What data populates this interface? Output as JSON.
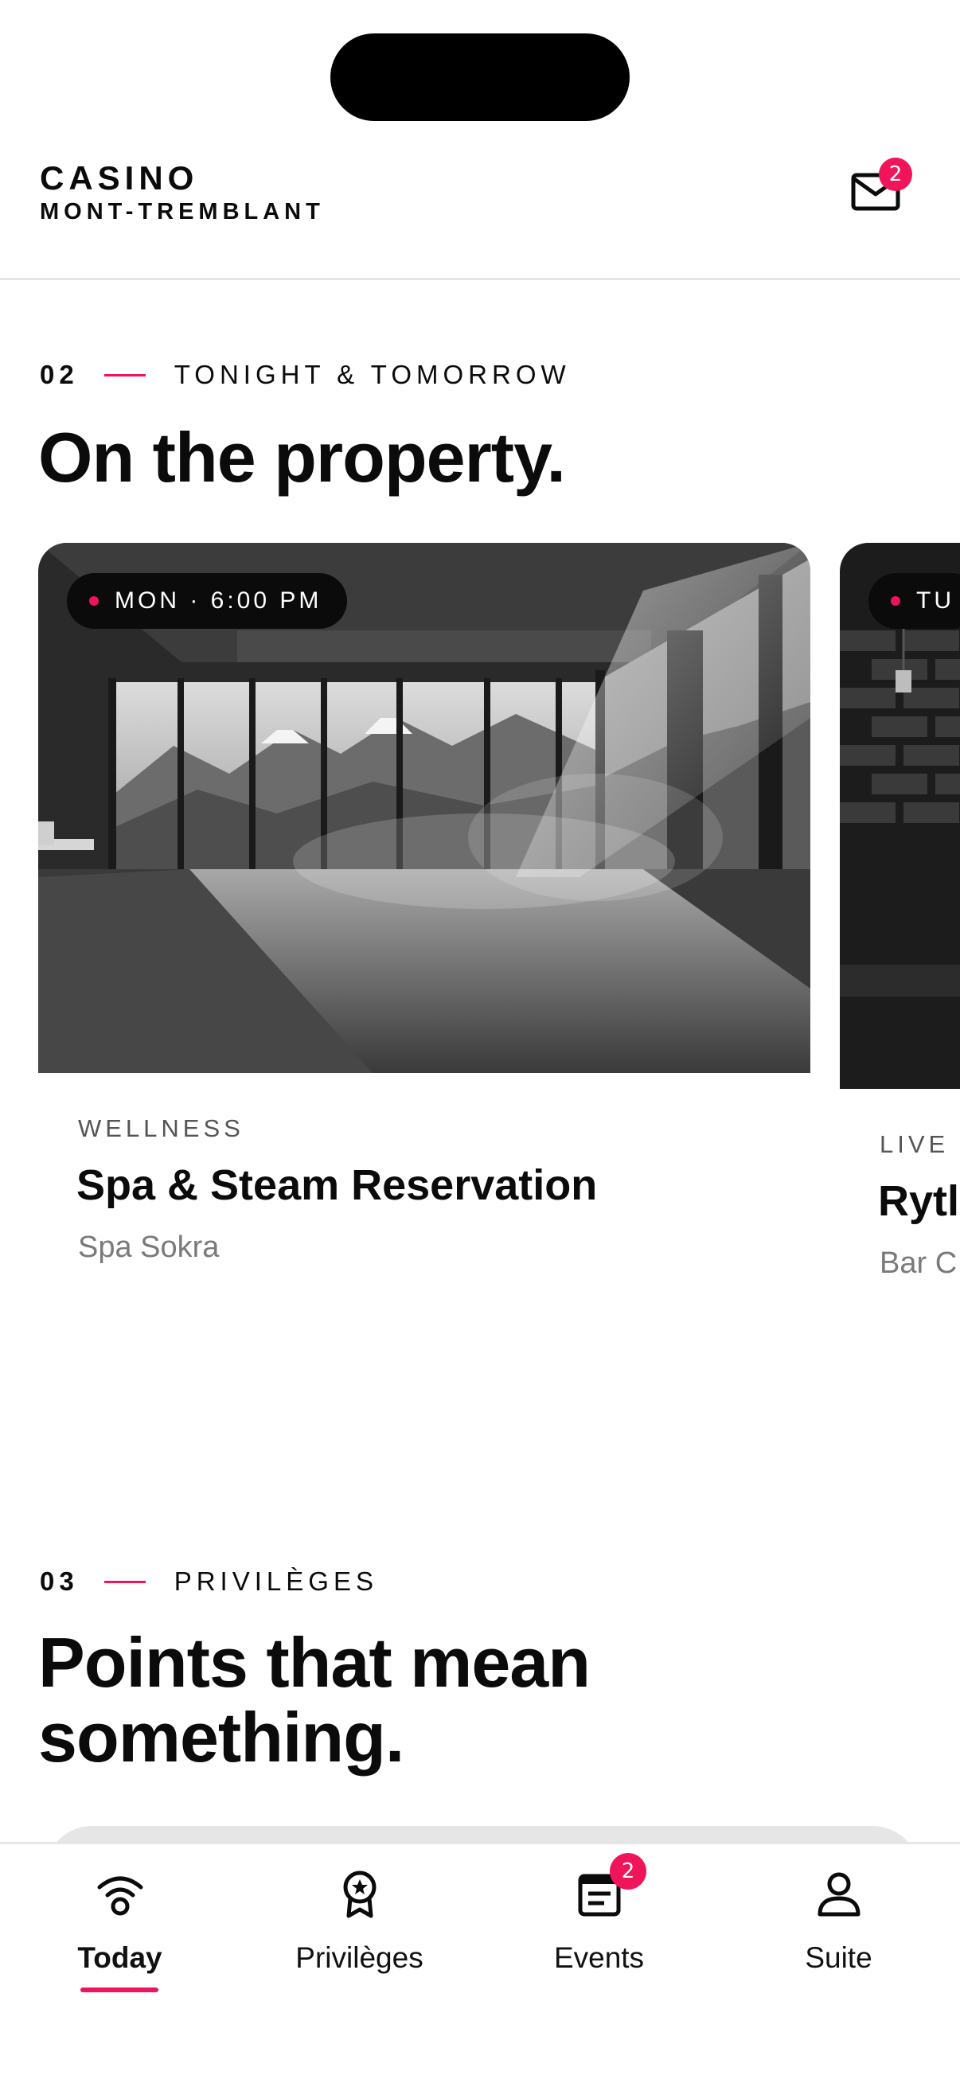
{
  "header": {
    "brand_line1": "CASINO",
    "brand_line2": "MONT-TREMBLANT",
    "mail_icon": "mail-icon",
    "mail_badge": "2"
  },
  "section_tonight": {
    "number": "02",
    "eyebrow": "TONIGHT & TOMORROW",
    "title": "On the property."
  },
  "cards": [
    {
      "time": "MON · 6:00 PM",
      "category": "WELLNESS",
      "title": "Spa & Steam Reservation",
      "venue": "Spa Sokra"
    },
    {
      "time": "TU",
      "category": "LIVE",
      "title": "Rytl",
      "venue": "Bar C"
    }
  ],
  "section_privileges": {
    "number": "03",
    "eyebrow": "PRIVILÈGES",
    "title_line1": "Points that mean",
    "title_line2": "something."
  },
  "tabbar": {
    "tabs": [
      {
        "label": "Today",
        "icon": "wifi-icon",
        "active": true
      },
      {
        "label": "Privilèges",
        "icon": "award-icon",
        "active": false
      },
      {
        "label": "Events",
        "icon": "calendar-list-icon",
        "active": false,
        "badge": "2"
      },
      {
        "label": "Suite",
        "icon": "user-icon",
        "active": false
      }
    ]
  },
  "colors": {
    "accent": "#f0145a",
    "text": "#0b0b0b",
    "muted": "#7a7a7a",
    "divider": "#e6e6e6"
  }
}
